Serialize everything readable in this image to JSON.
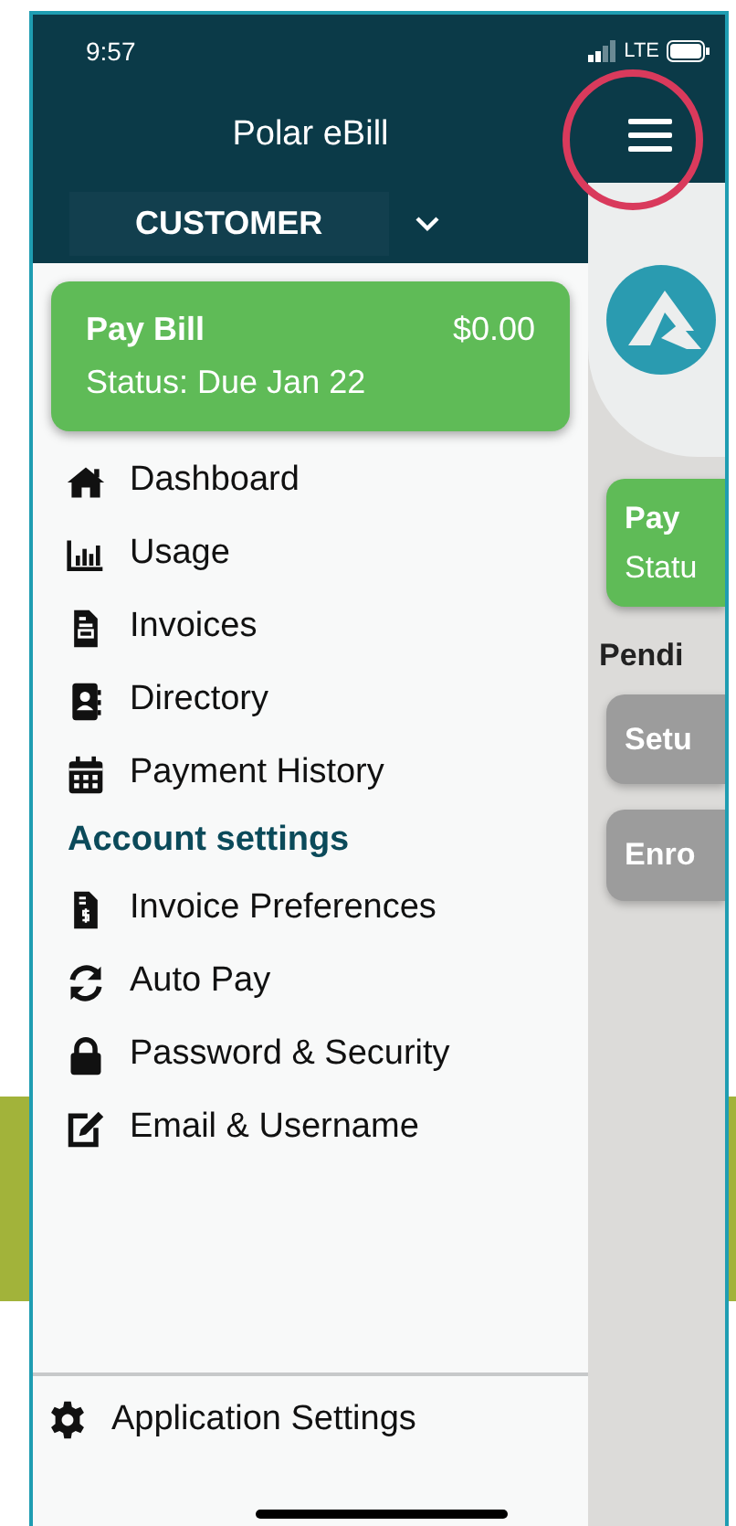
{
  "status_bar": {
    "time": "9:57",
    "network": "LTE"
  },
  "header": {
    "title": "Polar eBill"
  },
  "account_selector": {
    "label": "CUSTOMER"
  },
  "pay_bill_card": {
    "title": "Pay Bill",
    "amount": "$0.00",
    "status": "Status: Due Jan 22"
  },
  "menu_sections": [
    {
      "items": [
        {
          "label": "Dashboard"
        },
        {
          "label": "Usage"
        },
        {
          "label": "Invoices"
        },
        {
          "label": "Directory"
        },
        {
          "label": "Payment History"
        }
      ]
    },
    {
      "heading": "Account settings",
      "items": [
        {
          "label": "Invoice Preferences"
        },
        {
          "label": "Auto Pay"
        },
        {
          "label": "Password & Security"
        },
        {
          "label": "Email & Username"
        }
      ]
    }
  ],
  "footer_item": {
    "label": "Application Settings"
  },
  "background_screen": {
    "card_title": "Pay",
    "card_status": "Statu",
    "pending_label": "Pendi",
    "buttons": [
      "Setu",
      "Enro"
    ]
  }
}
